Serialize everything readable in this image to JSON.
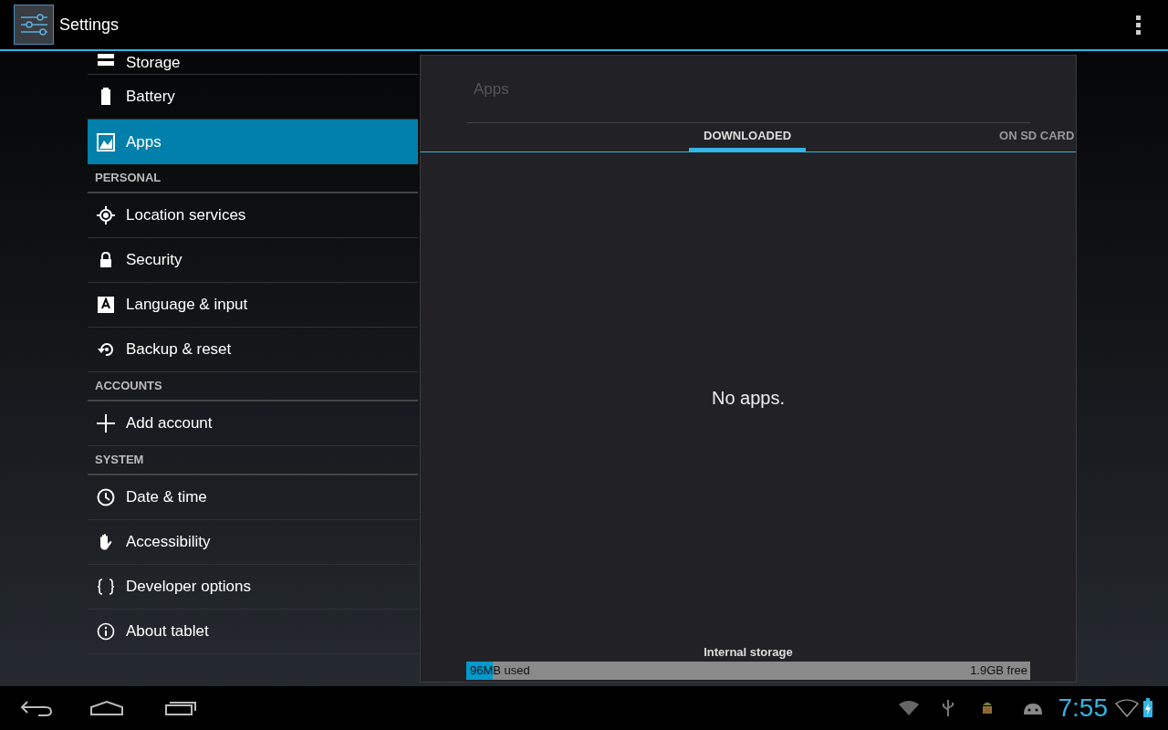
{
  "action_bar": {
    "title": "Settings"
  },
  "sidebar": {
    "items": [
      {
        "kind": "item",
        "label": "Storage",
        "selected": false
      },
      {
        "kind": "item",
        "label": "Battery",
        "selected": false
      },
      {
        "kind": "item",
        "label": "Apps",
        "selected": true
      },
      {
        "kind": "header",
        "label": "PERSONAL"
      },
      {
        "kind": "item",
        "label": "Location services",
        "selected": false
      },
      {
        "kind": "item",
        "label": "Security",
        "selected": false
      },
      {
        "kind": "item",
        "label": "Language & input",
        "selected": false
      },
      {
        "kind": "item",
        "label": "Backup & reset",
        "selected": false
      },
      {
        "kind": "header",
        "label": "ACCOUNTS"
      },
      {
        "kind": "item",
        "label": "Add account",
        "selected": false
      },
      {
        "kind": "header",
        "label": "SYSTEM"
      },
      {
        "kind": "item",
        "label": "Date & time",
        "selected": false
      },
      {
        "kind": "item",
        "label": "Accessibility",
        "selected": false
      },
      {
        "kind": "item",
        "label": "Developer options",
        "selected": false
      },
      {
        "kind": "item",
        "label": "About tablet",
        "selected": false
      }
    ]
  },
  "panel": {
    "title": "Apps",
    "tabs": [
      {
        "label": "DOWNLOADED",
        "selected": true
      },
      {
        "label": "ON SD CARD",
        "selected": false
      }
    ],
    "empty_message": "No apps.",
    "storage": {
      "label": "Internal storage",
      "level": 0.047,
      "used": "96MB used",
      "free": "1.9GB free"
    }
  },
  "status_bar": {
    "time": "7:55"
  }
}
